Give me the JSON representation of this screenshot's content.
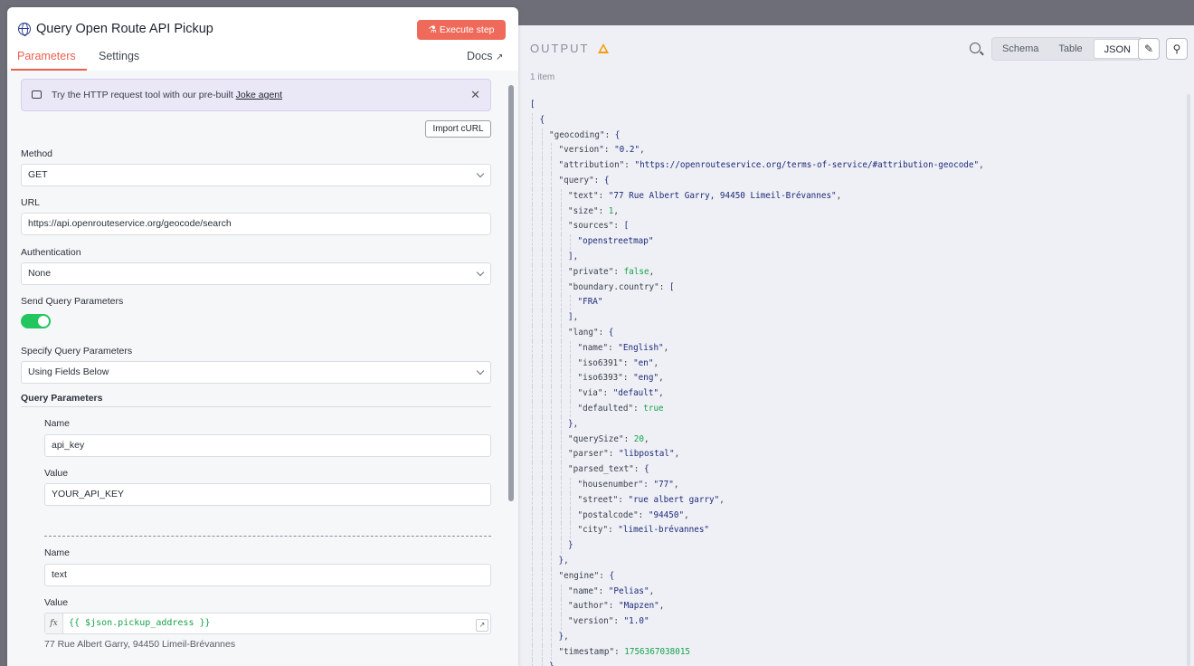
{
  "node": {
    "title": "Query Open Route API Pickup",
    "execute_label": "Execute step",
    "tabs": [
      "Parameters",
      "Settings"
    ],
    "docs_label": "Docs"
  },
  "notice": {
    "text": "Try the HTTP request tool with our pre-built ",
    "link": "Joke agent"
  },
  "import_curl_label": "Import cURL",
  "form": {
    "method_label": "Method",
    "method_value": "GET",
    "url_label": "URL",
    "url_value": "https://api.openrouteservice.org/geocode/search",
    "auth_label": "Authentication",
    "auth_value": "None",
    "send_query_label": "Send Query Parameters",
    "send_query_enabled": true,
    "specify_label": "Specify Query Parameters",
    "specify_value": "Using Fields Below",
    "query_params_label": "Query Parameters",
    "params": [
      {
        "name_label": "Name",
        "name": "api_key",
        "value_label": "Value",
        "value": "YOUR_API_KEY"
      },
      {
        "name_label": "Name",
        "name": "text",
        "value_label": "Value",
        "value": "{{ $json.pickup_address }}",
        "hint": "77 Rue Albert Garry, 94450 Limeil-Brévannes"
      }
    ]
  },
  "output": {
    "title": "OUTPUT",
    "item_count": "1 item",
    "views": [
      "Schema",
      "Table",
      "JSON"
    ],
    "active_view": "JSON",
    "json_lines": [
      {
        "d": 0,
        "t": [
          [
            "p",
            "["
          ]
        ]
      },
      {
        "d": 1,
        "t": [
          [
            "p",
            "{"
          ]
        ]
      },
      {
        "d": 2,
        "t": [
          [
            "k",
            "\"geocoding\": "
          ],
          [
            "p",
            "{"
          ]
        ]
      },
      {
        "d": 3,
        "t": [
          [
            "k",
            "\"version\": "
          ],
          [
            "s",
            "\"0.2\""
          ],
          [
            "k",
            ","
          ]
        ]
      },
      {
        "d": 3,
        "t": [
          [
            "k",
            "\"attribution\": "
          ],
          [
            "s",
            "\"https://openrouteservice.org/terms-of-service/#attribution-geocode\""
          ],
          [
            "k",
            ","
          ]
        ]
      },
      {
        "d": 3,
        "t": [
          [
            "k",
            "\"query\": "
          ],
          [
            "p",
            "{"
          ]
        ]
      },
      {
        "d": 4,
        "t": [
          [
            "k",
            "\"text\": "
          ],
          [
            "s",
            "\"77 Rue Albert Garry, 94450 Limeil-Brévannes\""
          ],
          [
            "k",
            ","
          ]
        ]
      },
      {
        "d": 4,
        "t": [
          [
            "k",
            "\"size\": "
          ],
          [
            "n",
            "1"
          ],
          [
            "k",
            ","
          ]
        ]
      },
      {
        "d": 4,
        "t": [
          [
            "k",
            "\"sources\": "
          ],
          [
            "p",
            "["
          ]
        ]
      },
      {
        "d": 5,
        "t": [
          [
            "s",
            "\"openstreetmap\""
          ]
        ]
      },
      {
        "d": 4,
        "t": [
          [
            "p",
            "]"
          ],
          [
            "k",
            ","
          ]
        ]
      },
      {
        "d": 4,
        "t": [
          [
            "k",
            "\"private\": "
          ],
          [
            "b",
            "false"
          ],
          [
            "k",
            ","
          ]
        ]
      },
      {
        "d": 4,
        "t": [
          [
            "k",
            "\"boundary.country\": "
          ],
          [
            "p",
            "["
          ]
        ]
      },
      {
        "d": 5,
        "t": [
          [
            "s",
            "\"FRA\""
          ]
        ]
      },
      {
        "d": 4,
        "t": [
          [
            "p",
            "]"
          ],
          [
            "k",
            ","
          ]
        ]
      },
      {
        "d": 4,
        "t": [
          [
            "k",
            "\"lang\": "
          ],
          [
            "p",
            "{"
          ]
        ]
      },
      {
        "d": 5,
        "t": [
          [
            "k",
            "\"name\": "
          ],
          [
            "s",
            "\"English\""
          ],
          [
            "k",
            ","
          ]
        ]
      },
      {
        "d": 5,
        "t": [
          [
            "k",
            "\"iso6391\": "
          ],
          [
            "s",
            "\"en\""
          ],
          [
            "k",
            ","
          ]
        ]
      },
      {
        "d": 5,
        "t": [
          [
            "k",
            "\"iso6393\": "
          ],
          [
            "s",
            "\"eng\""
          ],
          [
            "k",
            ","
          ]
        ]
      },
      {
        "d": 5,
        "t": [
          [
            "k",
            "\"via\": "
          ],
          [
            "s",
            "\"default\""
          ],
          [
            "k",
            ","
          ]
        ]
      },
      {
        "d": 5,
        "t": [
          [
            "k",
            "\"defaulted\": "
          ],
          [
            "b",
            "true"
          ]
        ]
      },
      {
        "d": 4,
        "t": [
          [
            "p",
            "}"
          ],
          [
            "k",
            ","
          ]
        ]
      },
      {
        "d": 4,
        "t": [
          [
            "k",
            "\"querySize\": "
          ],
          [
            "n",
            "20"
          ],
          [
            "k",
            ","
          ]
        ]
      },
      {
        "d": 4,
        "t": [
          [
            "k",
            "\"parser\": "
          ],
          [
            "s",
            "\"libpostal\""
          ],
          [
            "k",
            ","
          ]
        ]
      },
      {
        "d": 4,
        "t": [
          [
            "k",
            "\"parsed_text\": "
          ],
          [
            "p",
            "{"
          ]
        ]
      },
      {
        "d": 5,
        "t": [
          [
            "k",
            "\"housenumber\": "
          ],
          [
            "s",
            "\"77\""
          ],
          [
            "k",
            ","
          ]
        ]
      },
      {
        "d": 5,
        "t": [
          [
            "k",
            "\"street\": "
          ],
          [
            "s",
            "\"rue albert garry\""
          ],
          [
            "k",
            ","
          ]
        ]
      },
      {
        "d": 5,
        "t": [
          [
            "k",
            "\"postalcode\": "
          ],
          [
            "s",
            "\"94450\""
          ],
          [
            "k",
            ","
          ]
        ]
      },
      {
        "d": 5,
        "t": [
          [
            "k",
            "\"city\": "
          ],
          [
            "s",
            "\"limeil-brévannes\""
          ]
        ]
      },
      {
        "d": 4,
        "t": [
          [
            "p",
            "}"
          ]
        ]
      },
      {
        "d": 3,
        "t": [
          [
            "p",
            "}"
          ],
          [
            "k",
            ","
          ]
        ]
      },
      {
        "d": 3,
        "t": [
          [
            "k",
            "\"engine\": "
          ],
          [
            "p",
            "{"
          ]
        ]
      },
      {
        "d": 4,
        "t": [
          [
            "k",
            "\"name\": "
          ],
          [
            "s",
            "\"Pelias\""
          ],
          [
            "k",
            ","
          ]
        ]
      },
      {
        "d": 4,
        "t": [
          [
            "k",
            "\"author\": "
          ],
          [
            "s",
            "\"Mapzen\""
          ],
          [
            "k",
            ","
          ]
        ]
      },
      {
        "d": 4,
        "t": [
          [
            "k",
            "\"version\": "
          ],
          [
            "s",
            "\"1.0\""
          ]
        ]
      },
      {
        "d": 3,
        "t": [
          [
            "p",
            "}"
          ],
          [
            "k",
            ","
          ]
        ]
      },
      {
        "d": 3,
        "t": [
          [
            "k",
            "\"timestamp\": "
          ],
          [
            "n",
            "1756367038015"
          ]
        ]
      },
      {
        "d": 2,
        "t": [
          [
            "p",
            "}"
          ]
        ]
      }
    ]
  },
  "icons": {
    "node": "globe-icon",
    "execute": "flask-icon",
    "docs": "external-link-icon",
    "notice": "bag-icon",
    "close": "close-icon",
    "warning": "warning-icon",
    "search": "search-icon",
    "edit": "pencil-icon",
    "pin": "pin-icon",
    "select": "chevron-down-icon",
    "expression": "fx-icon"
  },
  "colors": {
    "accent": "#e8614f",
    "execute_bg": "#ef6a5a",
    "toggle_on": "#22c55e",
    "notice_bg": "#eae7f7",
    "json_string": "#1f2a7a",
    "json_number": "#16a34a",
    "warning": "#f59e0b"
  }
}
